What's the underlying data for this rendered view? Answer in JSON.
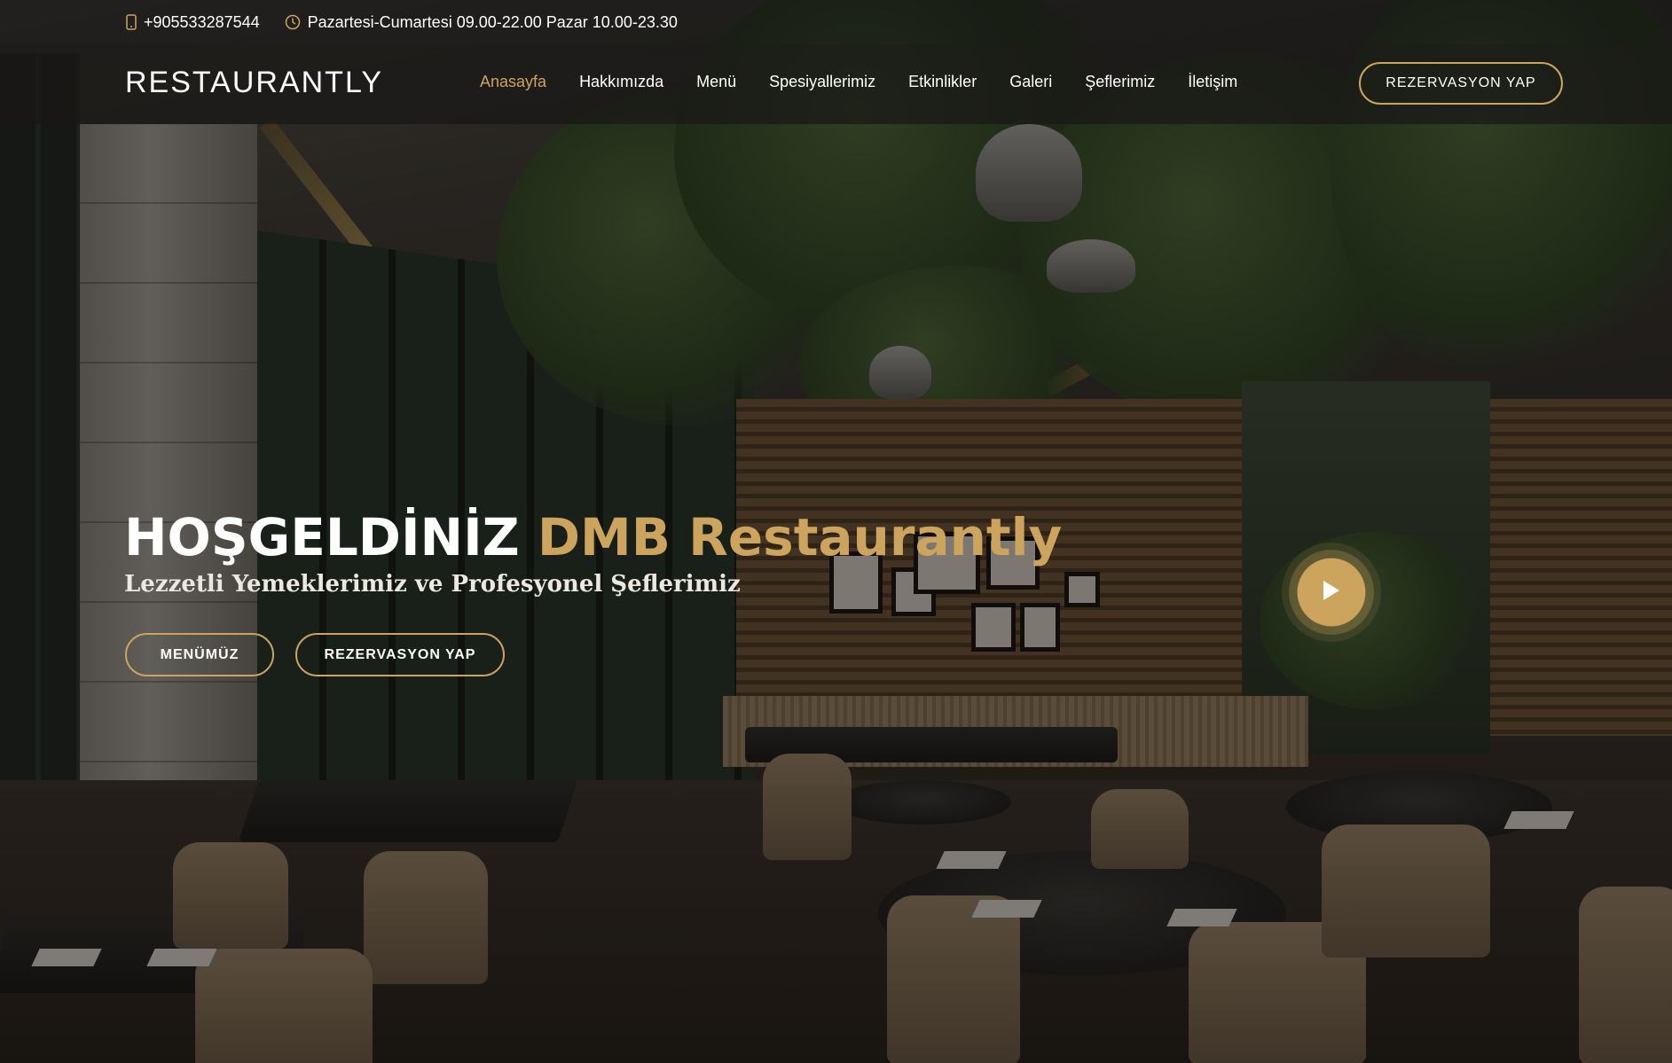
{
  "topbar": {
    "phone": "+905533287544",
    "hours": "Pazartesi-Cumartesi 09.00-22.00 Pazar 10.00-23.30",
    "phone_icon": "mobile-phone-icon",
    "clock_icon": "clock-icon"
  },
  "nav": {
    "logo": "RESTAURANTLY",
    "items": [
      {
        "label": "Anasayfa",
        "active": true
      },
      {
        "label": "Hakkımızda"
      },
      {
        "label": "Menü"
      },
      {
        "label": "Spesiyallerimiz"
      },
      {
        "label": "Etkinlikler"
      },
      {
        "label": "Galeri"
      },
      {
        "label": "Şeflerimiz"
      },
      {
        "label": "İletişim"
      }
    ],
    "cta": "REZERVASYON YAP"
  },
  "hero": {
    "title_main": "HOŞGELDİNİZ ",
    "title_accent": "DMB Restaurantly",
    "subtitle": "Lezzetli Yemeklerimiz ve Profesyonel Şeflerimiz",
    "btn_menu": "MENÜMÜZ",
    "btn_book": "REZERVASYON YAP",
    "play_icon": "play-icon"
  },
  "colors": {
    "accent": "#cda45e",
    "text": "#ffffff"
  }
}
